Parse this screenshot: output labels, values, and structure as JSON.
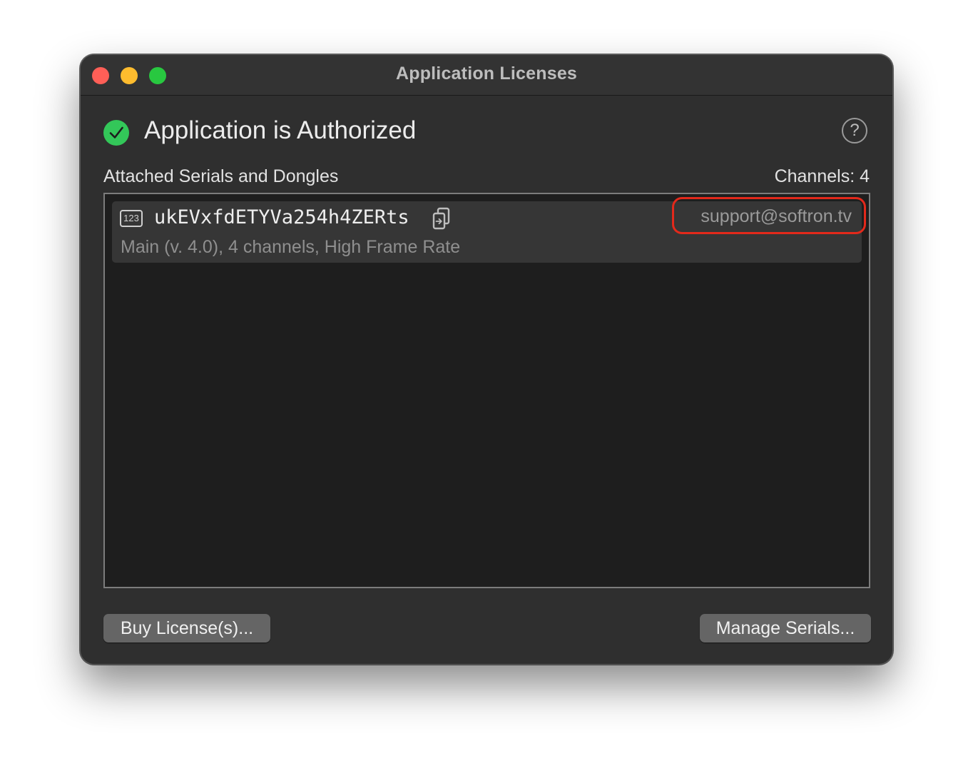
{
  "window": {
    "title": "Application Licenses"
  },
  "status": {
    "icon": "checkmark-circle-icon",
    "title": "Application is Authorized",
    "help_label": "?"
  },
  "licenses": {
    "section_label": "Attached Serials and Dongles",
    "channels_label": "Channels: 4",
    "rows": [
      {
        "type_icon_label": "123",
        "serial": "ukEVxfdETYVa254h4ZERts",
        "email": "support@softron.tv",
        "detail": "Main (v. 4.0), 4 channels, High Frame Rate"
      }
    ]
  },
  "buttons": {
    "buy": "Buy License(s)...",
    "manage": "Manage Serials..."
  },
  "colors": {
    "authorized_green": "#33c759",
    "highlight_red": "#e3291b"
  }
}
